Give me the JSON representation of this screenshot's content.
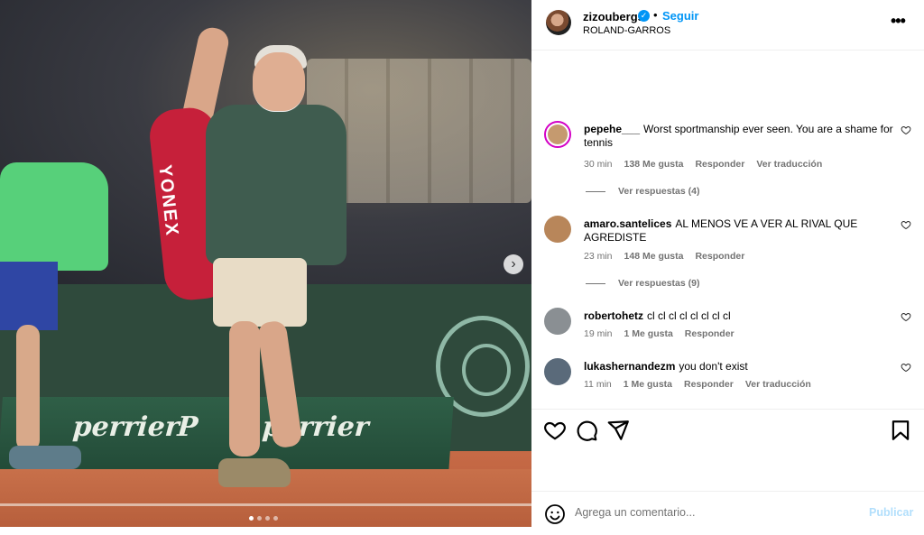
{
  "post": {
    "username": "zizoubergs",
    "verified": true,
    "separator": "•",
    "follow_label": "Seguir",
    "location": "ROLAND-GARROS",
    "more_icon": "more-horizontal-icon",
    "carousel": {
      "slide_count": 4,
      "active_index": 0,
      "next_icon": "chevron-right-icon"
    },
    "photo_text": {
      "bag_brand": "YONEX",
      "sponsor_1": "perrier",
      "sponsor_2": "P",
      "sponsor_3": "perrier"
    }
  },
  "comments": [
    {
      "username": "pepehe___",
      "text": "Worst sportmanship ever seen. You are a shame for tennis",
      "time": "30 min",
      "likes": "138 Me gusta",
      "reply": "Responder",
      "translate": "Ver traducción",
      "view_replies": "Ver respuestas (4)",
      "avatar_color": "#c59a6f"
    },
    {
      "username": "amaro.santelices",
      "text": "AL MENOS VE A VER AL RIVAL QUE AGREDISTE",
      "time": "23 min",
      "likes": "148 Me gusta",
      "reply": "Responder",
      "view_replies": "Ver respuestas (9)",
      "avatar_color": "#b8865a"
    },
    {
      "username": "robertohetz",
      "text": "cl cl cl cl cl cl cl cl",
      "time": "19 min",
      "likes": "1 Me gusta",
      "reply": "Responder",
      "avatar_color": "#8a8f93"
    },
    {
      "username": "lukashernandezm",
      "text": "you don't exist",
      "time": "11 min",
      "likes": "1 Me gusta",
      "reply": "Responder",
      "translate": "Ver traducción",
      "avatar_color": "#5a6a7a"
    }
  ],
  "actions": {
    "like_icon": "heart-icon",
    "comment_icon": "comment-icon",
    "share_icon": "send-icon",
    "save_icon": "bookmark-icon"
  },
  "composer": {
    "emoji_icon": "emoji-icon",
    "placeholder": "Agrega un comentario...",
    "publish_label": "Publicar"
  },
  "colors": {
    "accent": "#0095f6",
    "publish_disabled": "#b2dffc",
    "muted": "#737373"
  }
}
